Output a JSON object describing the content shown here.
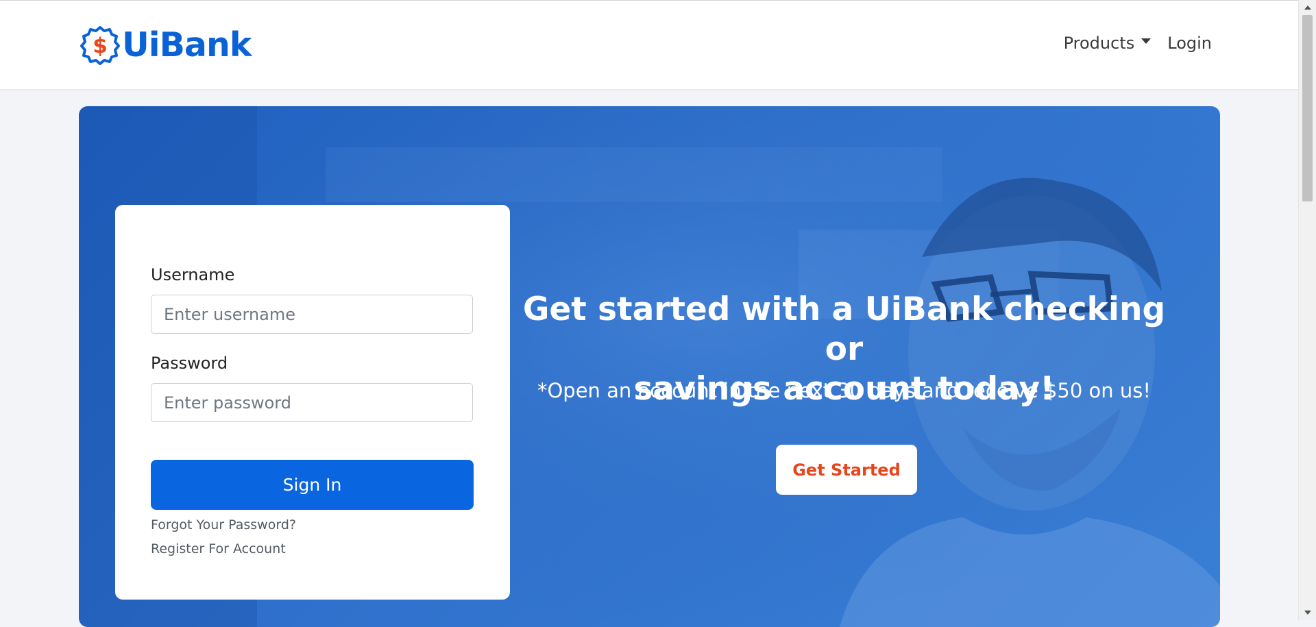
{
  "header": {
    "brand": "UiBank",
    "logo_symbol": "$",
    "nav": {
      "products_label": "Products",
      "login_label": "Login"
    }
  },
  "hero": {
    "headline_line1": "Get started with a UiBank checking or",
    "headline_line2": "savings account today!",
    "subline": "*Open an account in the next 30 days and receive $50 on us!",
    "cta_label": "Get Started"
  },
  "login_form": {
    "username_label": "Username",
    "username_placeholder": "Enter username",
    "username_value": "",
    "password_label": "Password",
    "password_placeholder": "Enter password",
    "password_value": "",
    "signin_label": "Sign In",
    "forgot_password_link": "Forgot Your Password?",
    "register_link": "Register For Account"
  },
  "colors": {
    "brand_blue": "#0a63d6",
    "brand_orange": "#e8451c",
    "hero_blue": "#2f71cc",
    "signin_blue": "#0a66e0"
  },
  "icons": [
    "dollar-badge-icon",
    "caret-down-icon",
    "scroll-up-icon",
    "scroll-down-icon"
  ]
}
